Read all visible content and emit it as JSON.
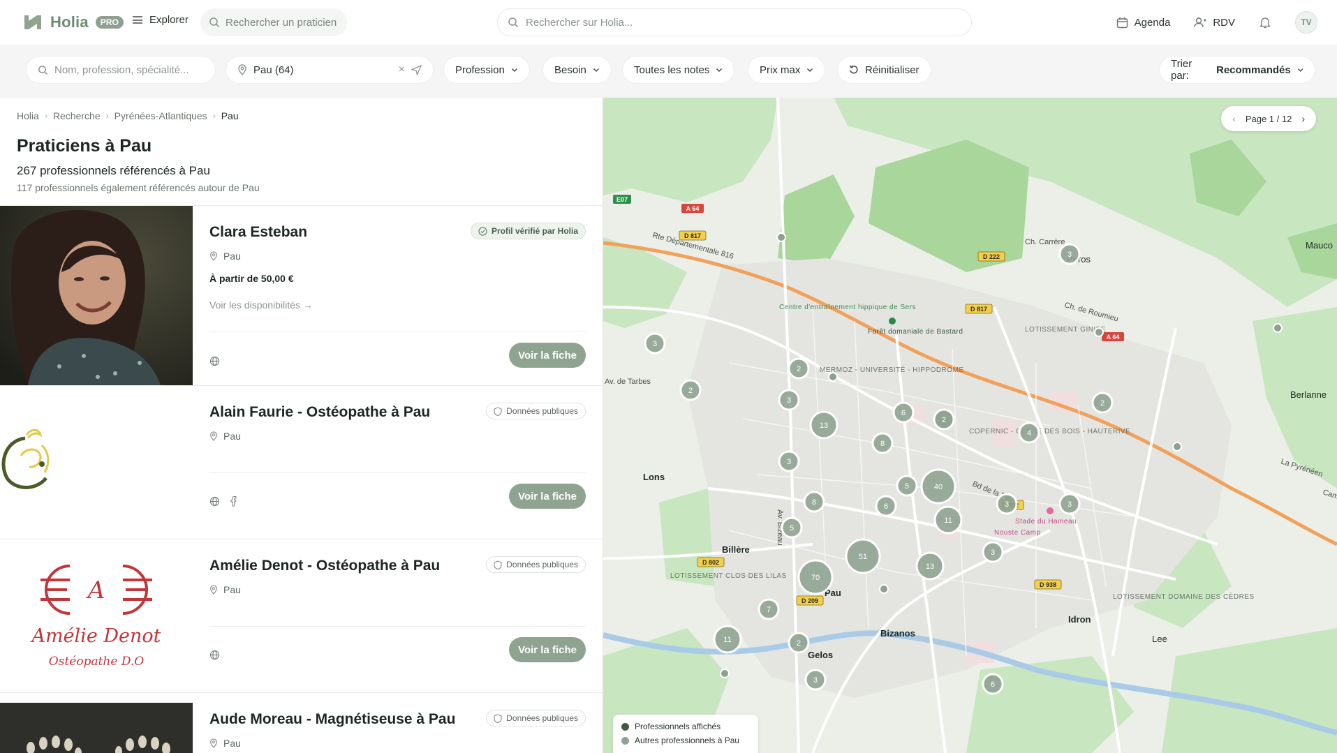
{
  "app": {
    "name": "Holia",
    "badge": "PRO"
  },
  "nav": {
    "explorer_label": "Explorer",
    "search_practitioner_placeholder": "Rechercher un praticien",
    "global_search_placeholder": "Rechercher sur Holia...",
    "agenda_label": "Agenda",
    "rdv_label": "RDV",
    "avatar_initials": "TV"
  },
  "filters": {
    "query_placeholder": "Nom, profession, spécialité...",
    "location_value": "Pau (64)",
    "profession_label": "Profession",
    "besoin_label": "Besoin",
    "notes_label": "Toutes les notes",
    "prix_label": "Prix max",
    "reset_label": "Réinitialiser",
    "sort_prefix": "Trier par:",
    "sort_value": "Recommandés"
  },
  "breadcrumb": [
    "Holia",
    "Recherche",
    "Pyrénées-Atlantiques",
    "Pau"
  ],
  "page": {
    "title": "Praticiens à Pau",
    "count_main": "267 professionnels référencés à Pau",
    "count_sub": "117 professionnels également référencés autour de Pau"
  },
  "results": [
    {
      "name": "Clara Esteban",
      "location": "Pau",
      "price": "À partir de 50,00 €",
      "availability": "Voir les disponibilités →",
      "badge": "Profil vérifié par Holia",
      "cta": "Voir la fiche"
    },
    {
      "name": "Alain Faurie - Ostéopathe à Pau",
      "location": "Pau",
      "badge": "Données publiques",
      "cta": "Voir la fiche"
    },
    {
      "name": "Amélie Denot - Ostéopathe à Pau",
      "location": "Pau",
      "badge": "Données publiques",
      "cta": "Voir la fiche",
      "logo_name": "Amélie Denot",
      "logo_sub": "Ostéopathe D.O",
      "logo_letter": "A"
    },
    {
      "name": "Aude Moreau - Magnétiseuse à Pau",
      "location": "Pau",
      "badge": "Données publiques"
    }
  ],
  "map": {
    "pager": "Page 1 / 12",
    "legend": [
      "Professionnels affichés",
      "Autres professionnels à Pau"
    ],
    "legend_colors": [
      "#3f5a44",
      "#8fa391"
    ],
    "places": [
      "Lons",
      "Billère",
      "Pau",
      "Bizanos",
      "Gelos",
      "Idron",
      "Lee",
      "Berlanne",
      "Puros",
      "Mauco"
    ],
    "poi": [
      "Centre d'entraînement hippique de Sers",
      "Forêt domaniale de Bastard",
      "MERMOZ - UNIVERSITÉ - HIPPODROME",
      "COPERNIC - OUSSE DES BOIS - HAUTERIVE",
      "LOTISSEMENT CLOS DES LILAS",
      "LOTISSEMENT DOMAINE DES CÈDRES",
      "LOTISSEMENT GINIBE",
      "Stade du Hameau",
      "Nouste Camp"
    ],
    "roads": [
      "Rte Départementale 816",
      "Av. de Tarbes",
      "Av. Bizeau",
      "Bd de la Paix",
      "Ch. Carrère",
      "Ch. de Roumieu",
      "La Pyrénéen",
      "Cam."
    ],
    "road_badges": [
      "E07",
      "A 64",
      "D 817",
      "D 222",
      "D 817",
      "A 64",
      "D 802",
      "D 802",
      "D 209",
      "D 938"
    ],
    "clusters": [
      3,
      2,
      2,
      3,
      3,
      2,
      13,
      6,
      2,
      8,
      4,
      3,
      5,
      40,
      6,
      11,
      3,
      8,
      5,
      51,
      13,
      3,
      70,
      7,
      11,
      2,
      3,
      6,
      2,
      3
    ]
  }
}
